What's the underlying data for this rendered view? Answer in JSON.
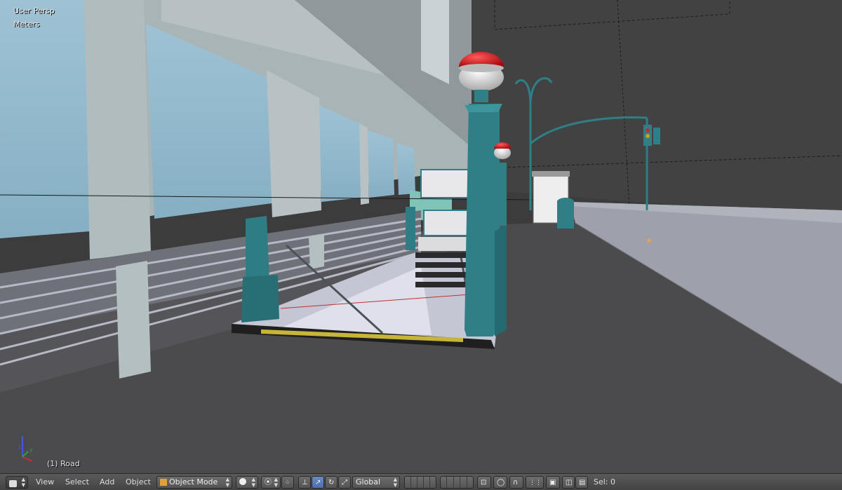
{
  "viewport": {
    "view_label": "User Persp",
    "units_label": "Meters",
    "active_object_label": "(1) Road"
  },
  "header": {
    "editor_type_icon": "3d-view-icon",
    "menus": [
      "View",
      "Select",
      "Add",
      "Object"
    ],
    "mode_selector": {
      "icon": "object-cube-icon",
      "value": "Object Mode"
    },
    "shading_icon": "solid-sphere-icon",
    "pivot_icon": "pivot-point-icon",
    "snap_icon": "manipulator-icon",
    "transform_orientation": "Global",
    "selection_count": "Sel: 0"
  },
  "colors": {
    "teal": "#2e7f86",
    "globe_red": "#c0161c",
    "sky_glass": "#8fb6cc",
    "building": "#a7b3b5",
    "road": "#4a4a4c",
    "sidewalk_right": "#9d9faa"
  }
}
